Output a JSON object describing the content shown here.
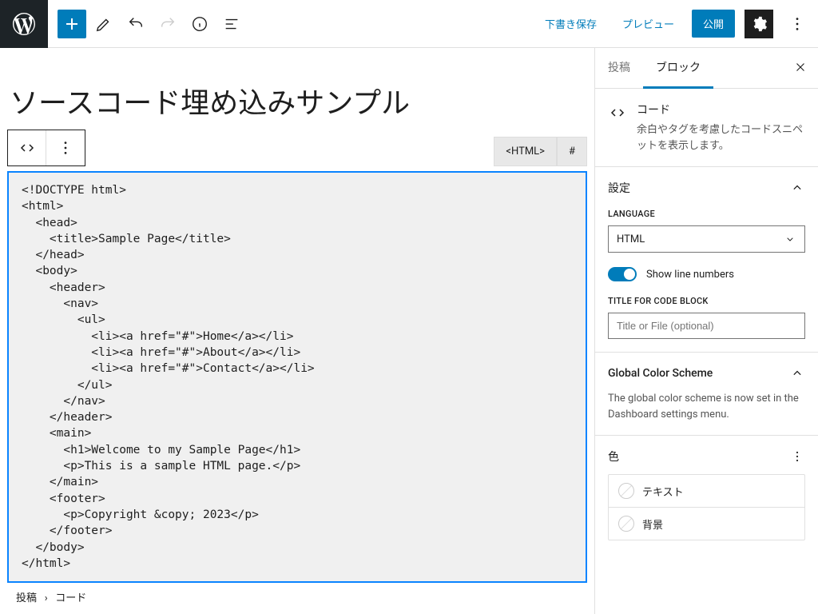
{
  "topbar": {
    "save_draft": "下書き保存",
    "preview": "プレビュー",
    "publish": "公開"
  },
  "editor": {
    "title": "ソースコード埋め込みサンプル",
    "tab_html": "<HTML>",
    "tab_hash": "#",
    "code": "<!DOCTYPE html>\n<html>\n  <head>\n    <title>Sample Page</title>\n  </head>\n  <body>\n    <header>\n      <nav>\n        <ul>\n          <li><a href=\"#\">Home</a></li>\n          <li><a href=\"#\">About</a></li>\n          <li><a href=\"#\">Contact</a></li>\n        </ul>\n      </nav>\n    </header>\n    <main>\n      <h1>Welcome to my Sample Page</h1>\n      <p>This is a sample HTML page.</p>\n    </main>\n    <footer>\n      <p>Copyright &copy; 2023</p>\n    </footer>\n  </body>\n</html>"
  },
  "breadcrumb": {
    "root": "投稿",
    "sep": "›",
    "current": "コード"
  },
  "sidebar": {
    "tab_post": "投稿",
    "tab_block": "ブロック",
    "block": {
      "name": "コード",
      "desc": "余白やタグを考慮したコードスニペットを表示します。"
    },
    "settings": {
      "title": "設定",
      "language_label": "LANGUAGE",
      "language_value": "HTML",
      "show_line_numbers": "Show line numbers",
      "title_label": "TITLE FOR CODE BLOCK",
      "title_placeholder": "Title or File (optional)"
    },
    "global_color": {
      "title": "Global Color Scheme",
      "desc": "The global color scheme is now set in the Dashboard settings menu."
    },
    "color": {
      "title": "色",
      "text": "テキスト",
      "background": "背景"
    }
  }
}
